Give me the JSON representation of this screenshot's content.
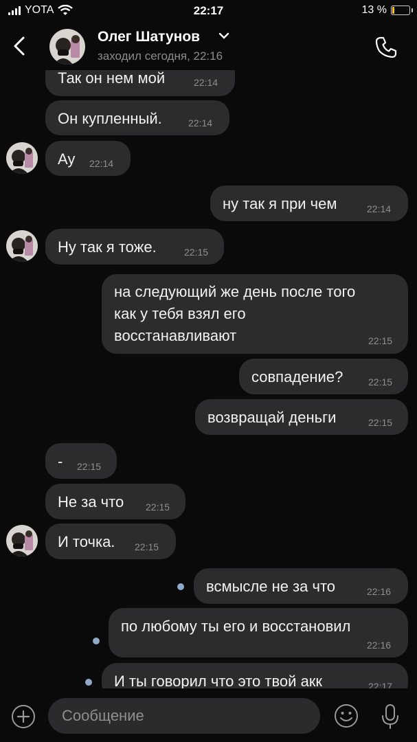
{
  "status_bar": {
    "carrier": "YOTA",
    "time": "22:17",
    "battery": "13 %",
    "battery_level": 0.13
  },
  "header": {
    "name": "Олег Шатунов",
    "last_seen": "заходил сегодня, 22:16"
  },
  "messages": [
    {
      "text": "Так он нем мой",
      "time": "22:14"
    },
    {
      "text": "Он купленный.",
      "time": "22:14"
    },
    {
      "text": "Ау",
      "time": "22:14"
    },
    {
      "text": "ну так я при чем",
      "time": "22:14"
    },
    {
      "text": "Ну так я тоже.",
      "time": "22:15"
    },
    {
      "lines": [
        "на следующий же день после того",
        "как у тебя взял его",
        "восстанавливают"
      ],
      "time": "22:15"
    },
    {
      "text": "совпадение?",
      "time": "22:15"
    },
    {
      "text": "возвращай деньги",
      "time": "22:15"
    },
    {
      "text": "-",
      "time": "22:15"
    },
    {
      "text": "Не за что",
      "time": "22:15"
    },
    {
      "text": "И точка.",
      "time": "22:15"
    },
    {
      "text": "всмысле не за что",
      "time": "22:16"
    },
    {
      "text": "по любому ты его и восстановил",
      "time": "22:16"
    },
    {
      "text": "И ты говорил что это твой акк",
      "time": "22:17"
    }
  ],
  "input": {
    "placeholder": "Сообщение"
  },
  "colors": {
    "background": "#0a0a0a",
    "bubble": "#2c2c2e",
    "unread_dot": "#8fa9c9",
    "battery": "#f4c51b"
  }
}
